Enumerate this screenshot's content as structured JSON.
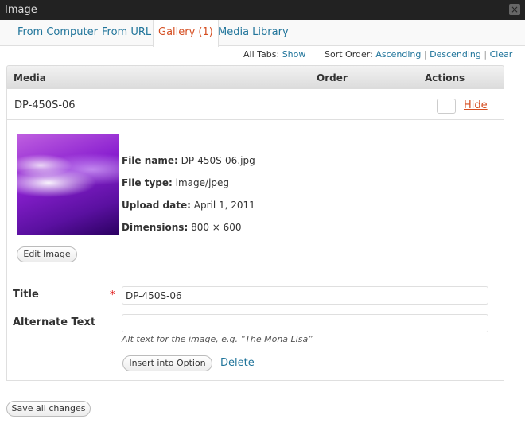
{
  "window": {
    "title": "Image",
    "close_icon": "close-icon"
  },
  "tabs": [
    {
      "label": "From Computer"
    },
    {
      "label": "From URL"
    },
    {
      "label": "Gallery (1)",
      "active": true
    },
    {
      "label": "Media Library"
    }
  ],
  "sort_bar": {
    "all_tabs_label": "All Tabs:",
    "show_link": "Show",
    "sort_order_label": "Sort Order:",
    "ascending": "Ascending",
    "descending": "Descending",
    "clear": "Clear",
    "separator": "|"
  },
  "table": {
    "headers": {
      "media": "Media",
      "order": "Order",
      "actions": "Actions"
    },
    "row": {
      "filename": "DP-450S-06",
      "order_value": "",
      "hide_link": "Hide"
    }
  },
  "details": {
    "file_name_label": "File name:",
    "file_name": "DP-450S-06.jpg",
    "file_type_label": "File type:",
    "file_type": "image/jpeg",
    "upload_date_label": "Upload date:",
    "upload_date": "April 1, 2011",
    "dimensions_label": "Dimensions:",
    "dimensions": "800 × 600",
    "edit_button": "Edit Image"
  },
  "form": {
    "title_label": "Title",
    "required_mark": "*",
    "title_value": "DP-450S-06",
    "alt_label": "Alternate Text",
    "alt_value": "",
    "alt_help": "Alt text for the image, e.g. “The Mona Lisa”",
    "insert_button": "Insert into Option",
    "delete_link": "Delete"
  },
  "footer": {
    "save_button": "Save all changes"
  },
  "colors": {
    "link": "#21759b",
    "active_tab": "#d54e21",
    "titlebar": "#222222"
  }
}
